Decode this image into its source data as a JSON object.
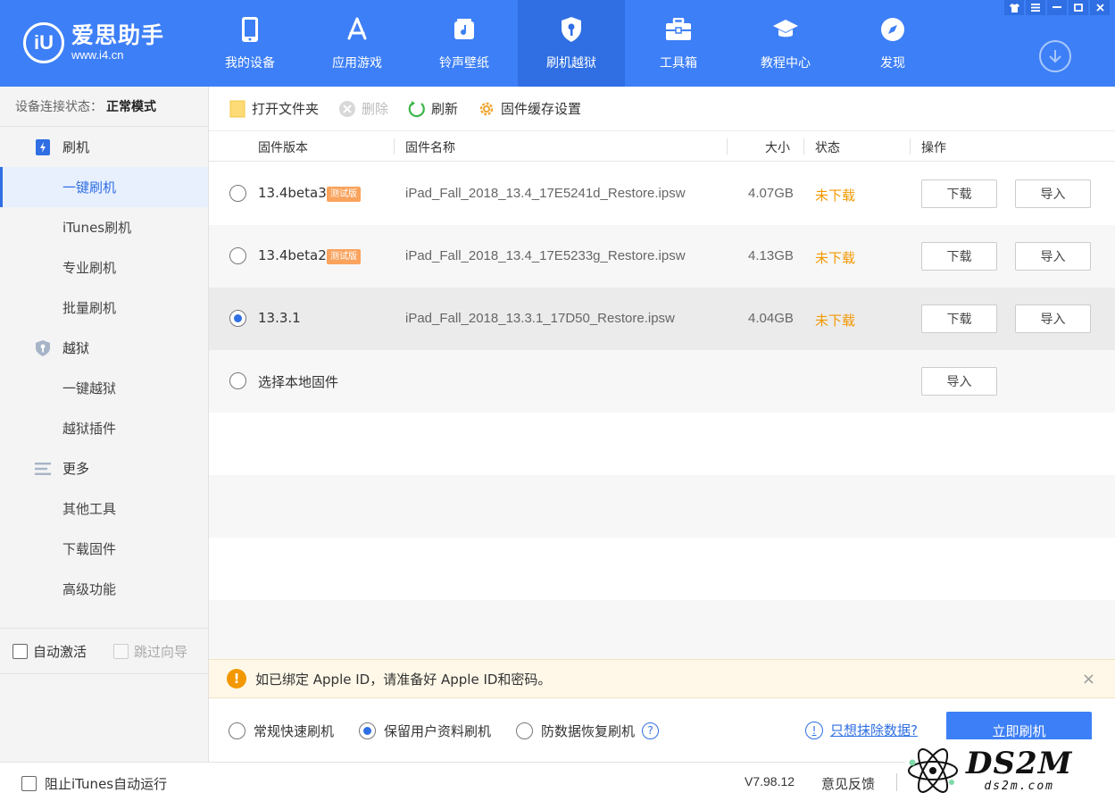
{
  "app": {
    "logo_name": "爱思助手",
    "logo_url": "www.i4.cn",
    "logo_badge": "iU"
  },
  "nav": [
    {
      "label": "我的设备",
      "icon": "phone-icon"
    },
    {
      "label": "应用游戏",
      "icon": "app-store-icon"
    },
    {
      "label": "铃声壁纸",
      "icon": "music-icon"
    },
    {
      "label": "刷机越狱",
      "icon": "shield-key-icon"
    },
    {
      "label": "工具箱",
      "icon": "toolbox-icon"
    },
    {
      "label": "教程中心",
      "icon": "graduation-cap-icon"
    },
    {
      "label": "发现",
      "icon": "compass-icon"
    }
  ],
  "active_nav": "刷机越狱",
  "sidebar": {
    "conn_label": "设备连接状态：",
    "conn_value": "正常模式",
    "groups": [
      {
        "label": "刷机",
        "items": [
          "一键刷机",
          "iTunes刷机",
          "专业刷机",
          "批量刷机"
        ]
      },
      {
        "label": "越狱",
        "items": [
          "一键越狱",
          "越狱插件"
        ]
      },
      {
        "label": "更多",
        "items": [
          "其他工具",
          "下载固件",
          "高级功能"
        ]
      }
    ],
    "active_item": "一键刷机",
    "auto_activate": "自动激活",
    "skip_guide": "跳过向导"
  },
  "toolbar": {
    "open_folder": "打开文件夹",
    "delete": "删除",
    "refresh": "刷新",
    "cache_settings": "固件缓存设置"
  },
  "table": {
    "headers": {
      "version": "固件版本",
      "name": "固件名称",
      "size": "大小",
      "status": "状态",
      "ops": "操作"
    },
    "rows": [
      {
        "version": "13.4beta3",
        "badge": "测试版",
        "name": "iPad_Fall_2018_13.4_17E5241d_Restore.ipsw",
        "size": "4.07GB",
        "status": "未下载",
        "download": "下载",
        "import": "导入",
        "selected": false
      },
      {
        "version": "13.4beta2",
        "badge": "测试版",
        "name": "iPad_Fall_2018_13.4_17E5233g_Restore.ipsw",
        "size": "4.13GB",
        "status": "未下载",
        "download": "下载",
        "import": "导入",
        "selected": false
      },
      {
        "version": "13.3.1",
        "badge": "",
        "name": "iPad_Fall_2018_13.3.1_17D50_Restore.ipsw",
        "size": "4.04GB",
        "status": "未下载",
        "download": "下载",
        "import": "导入",
        "selected": true
      }
    ],
    "local": {
      "label": "选择本地固件",
      "import": "导入"
    }
  },
  "notice": {
    "text": "如已绑定 Apple ID，请准备好 Apple ID和密码。",
    "close": "×"
  },
  "modes": {
    "options": [
      "常规快速刷机",
      "保留用户资料刷机",
      "防数据恢复刷机"
    ],
    "selected": "保留用户资料刷机",
    "help": "?",
    "erase_link": "只想抹除数据?",
    "flash_button": "立即刷机"
  },
  "footer": {
    "block_itunes": "阻止iTunes自动运行",
    "version": "V7.98.12",
    "feedback": "意见反馈"
  },
  "watermark": {
    "big": "DS2M",
    "small": "ds2m.com"
  },
  "colors": {
    "accent": "#3d7ff6",
    "nav_active": "#2f6fe3",
    "status_orange": "#f39800",
    "badge_orange": "#f9a35d"
  }
}
